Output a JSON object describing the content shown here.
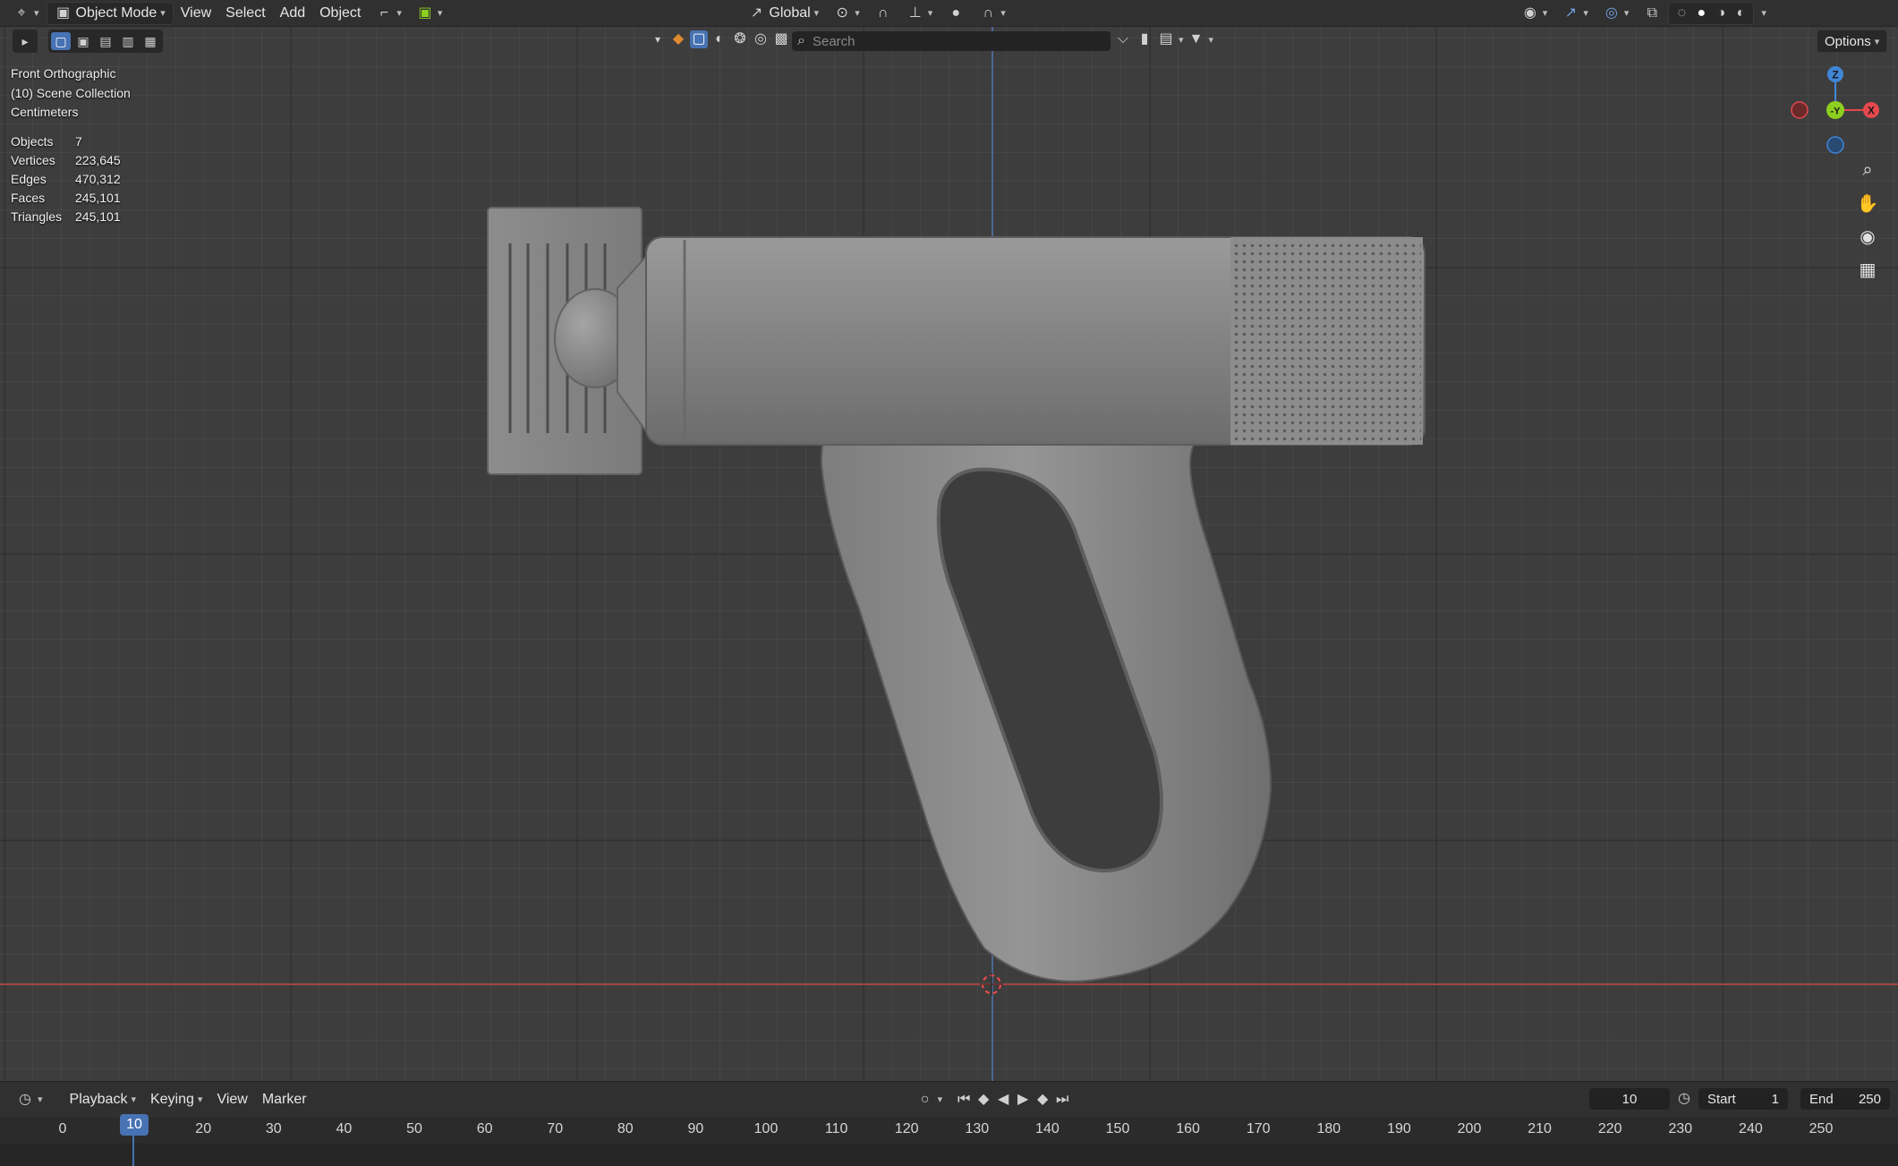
{
  "header": {
    "mode": "Object Mode",
    "menus": [
      "View",
      "Select",
      "Add",
      "Object"
    ],
    "transform_orientation": "Global",
    "options": "Options"
  },
  "search": {
    "placeholder": "Search"
  },
  "overlay": {
    "view": "Front Orthographic",
    "collection": "(10) Scene Collection",
    "units": "Centimeters"
  },
  "stats": [
    {
      "label": "Objects",
      "value": "7"
    },
    {
      "label": "Vertices",
      "value": "223,645"
    },
    {
      "label": "Edges",
      "value": "470,312"
    },
    {
      "label": "Faces",
      "value": "245,101"
    },
    {
      "label": "Triangles",
      "value": "245,101"
    }
  ],
  "gizmo": {
    "z": "Z",
    "y": "-Y",
    "x": "X"
  },
  "timeline": {
    "menus": [
      "Playback",
      "Keying",
      "View",
      "Marker"
    ],
    "current_frame": "10",
    "start_label": "Start",
    "start": "1",
    "end_label": "End",
    "end": "250",
    "ticks": [
      "0",
      "10",
      "20",
      "30",
      "40",
      "50",
      "60",
      "70",
      "80",
      "90",
      "100",
      "110",
      "120",
      "130",
      "140",
      "150",
      "160",
      "170",
      "180",
      "190",
      "200",
      "210",
      "220",
      "230",
      "240",
      "250"
    ]
  },
  "colors": {
    "accent": "#4772b3",
    "axis_x": "#a24444",
    "axis_z": "#4f6fa5",
    "gizmo_x": "#e5484d",
    "gizmo_y": "#8ccf1f",
    "gizmo_z": "#3f86d6"
  },
  "icons": [
    "editor-type-icon",
    "object-mode-icon",
    "transform-icon",
    "pivot-icon",
    "snap-icon",
    "proportional-icon",
    "visibility-icon",
    "gizmo-icon",
    "overlay-icon",
    "xray-icon",
    "shading-wire-icon",
    "shading-solid-icon",
    "shading-material-icon",
    "shading-render-icon",
    "zoom-icon",
    "hand-icon",
    "camera-icon",
    "grid-icon",
    "filter-icon",
    "bookmark-icon",
    "play-icon",
    "clock-icon"
  ]
}
